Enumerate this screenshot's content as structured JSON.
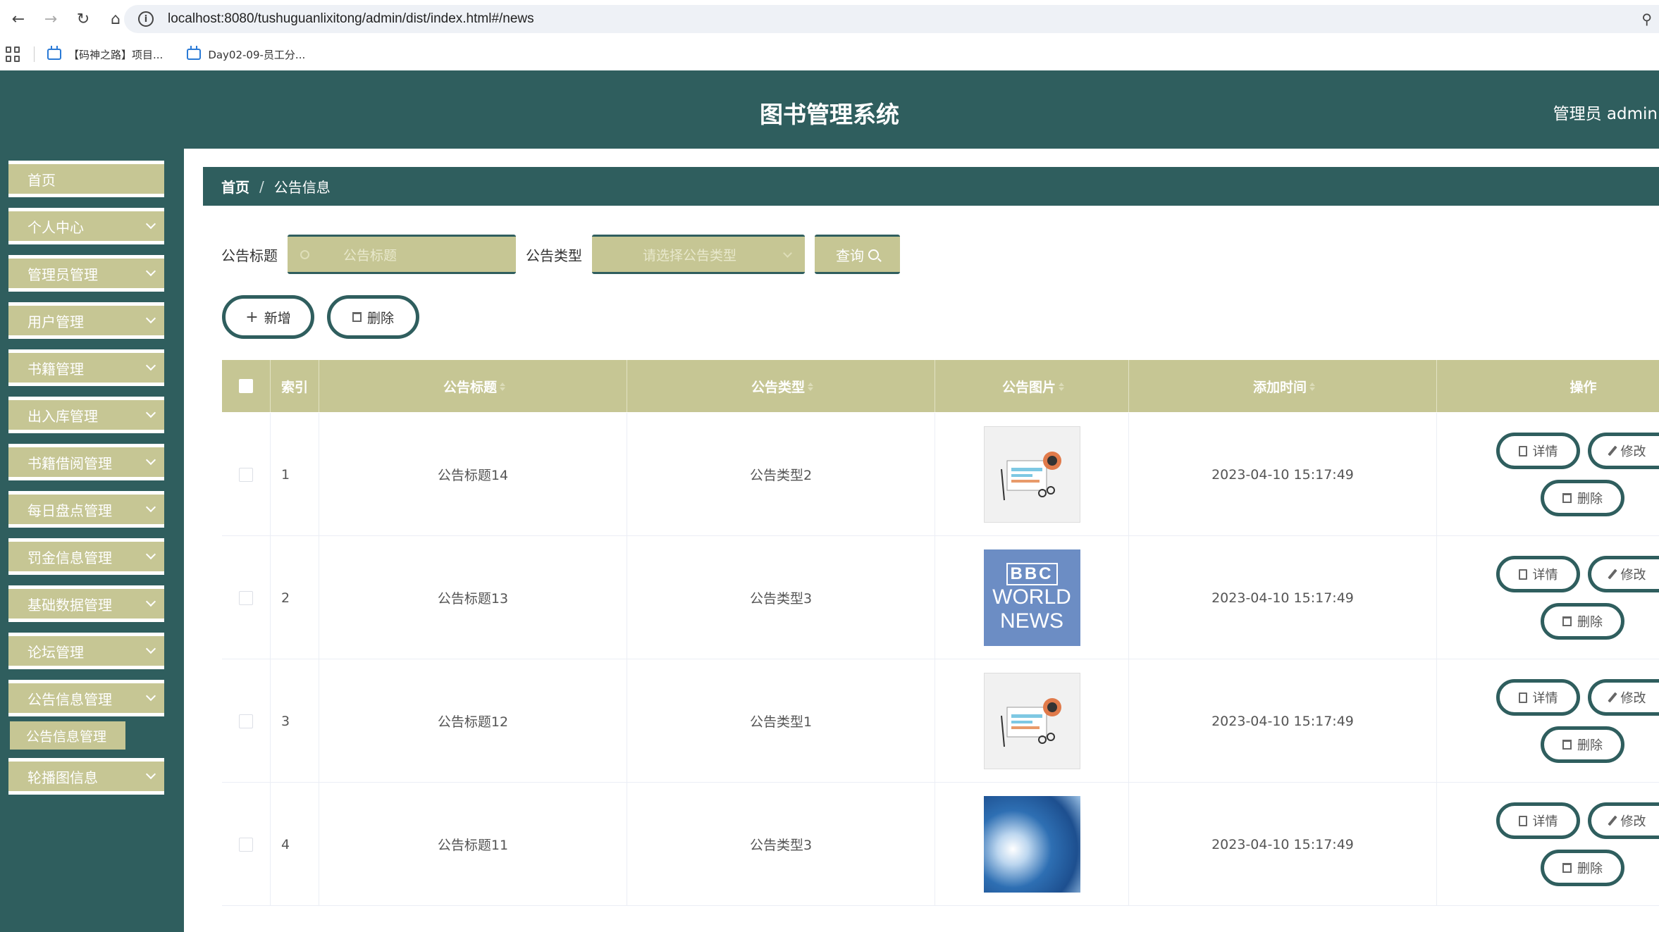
{
  "browser": {
    "url": "localhost:8080/tushuguanlixitong/admin/dist/index.html#/news",
    "bookmarks": [
      "【码神之路】项目...",
      "Day02-09-员工分..."
    ]
  },
  "header": {
    "title": "图书管理系统",
    "user": "管理员 admin"
  },
  "sidebar": {
    "items": [
      {
        "label": "首页",
        "has_arrow": false
      },
      {
        "label": "个人中心",
        "has_arrow": true
      },
      {
        "label": "管理员管理",
        "has_arrow": true
      },
      {
        "label": "用户管理",
        "has_arrow": true
      },
      {
        "label": "书籍管理",
        "has_arrow": true
      },
      {
        "label": "出入库管理",
        "has_arrow": true
      },
      {
        "label": "书籍借阅管理",
        "has_arrow": true
      },
      {
        "label": "每日盘点管理",
        "has_arrow": true
      },
      {
        "label": "罚金信息管理",
        "has_arrow": true
      },
      {
        "label": "基础数据管理",
        "has_arrow": true
      },
      {
        "label": "论坛管理",
        "has_arrow": true
      },
      {
        "label": "公告信息管理",
        "has_arrow": true
      }
    ],
    "subitem": "公告信息管理",
    "last_item": "轮播图信息"
  },
  "breadcrumb": {
    "home": "首页",
    "sep": "/",
    "current": "公告信息"
  },
  "search": {
    "title_label": "公告标题",
    "title_placeholder": "公告标题",
    "type_label": "公告类型",
    "type_placeholder": "请选择公告类型",
    "query_button": "查询"
  },
  "actions": {
    "add": "新增",
    "delete": "删除"
  },
  "table": {
    "columns": [
      "索引",
      "公告标题",
      "公告类型",
      "公告图片",
      "添加时间",
      "操作"
    ],
    "rows": [
      {
        "index": "1",
        "title": "公告标题14",
        "type": "公告类型2",
        "image": "news-paper",
        "time": "2023-04-10 15:17:49"
      },
      {
        "index": "2",
        "title": "公告标题13",
        "type": "公告类型3",
        "image": "bbc-world-news",
        "time": "2023-04-10 15:17:49"
      },
      {
        "index": "3",
        "title": "公告标题12",
        "type": "公告类型1",
        "image": "news-paper",
        "time": "2023-04-10 15:17:49"
      },
      {
        "index": "4",
        "title": "公告标题11",
        "type": "公告类型3",
        "image": "news-globe",
        "time": "2023-04-10 15:17:49"
      }
    ],
    "row_buttons": {
      "detail": "详情",
      "edit": "修改",
      "delete": "删除"
    }
  },
  "bbc": {
    "logo": "BBC",
    "line1": "WORLD",
    "line2": "NEWS"
  },
  "colors": {
    "primary": "#2f5e5e",
    "accent": "#c6c694"
  }
}
